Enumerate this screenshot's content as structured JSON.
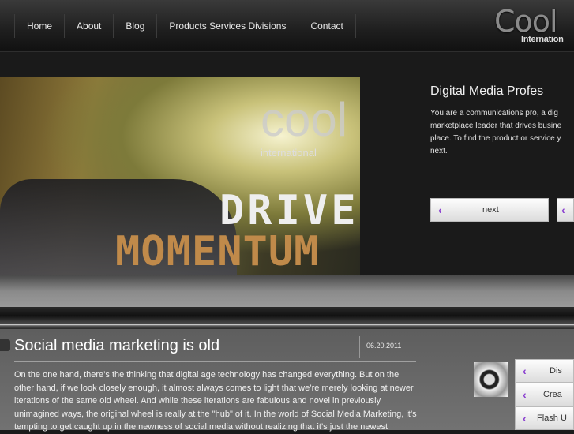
{
  "nav": {
    "items": [
      "Home",
      "About",
      "Blog",
      "Products Services Divisions",
      "Contact"
    ]
  },
  "logo": {
    "word": "Cool",
    "sub": "Internation"
  },
  "hero": {
    "drive": "DRIVE",
    "momentum": "MOMENTUM",
    "logo_text": "international",
    "logo_word": "cool"
  },
  "feature": {
    "title": "Digital Media Profes",
    "text": "You are a communications pro, a dig marketplace leader that drives busine place. To find the product or service y next.",
    "next_label": "next",
    "prev_chevron": "‹"
  },
  "post": {
    "title": "Social media marketing is old",
    "date": "06.20.2011",
    "body": "On the one hand, there’s the thinking that digital age technology has changed everything. But on the other hand, if we look closely enough, it almost always comes to light that we’re merely looking at newer iterations of the same old wheel. And while these iterations are fabulous and novel in previously unimagined ways, the original wheel is really at the \"hub\" of it. In the world of Social Media Marketing, it’s tempting to get caught up in the newness of social media without realizing that it’s just the newest"
  },
  "side": {
    "items": [
      "Dis",
      "Crea",
      "Flash U"
    ]
  },
  "colors": {
    "chevron": "#8a3fd0"
  }
}
